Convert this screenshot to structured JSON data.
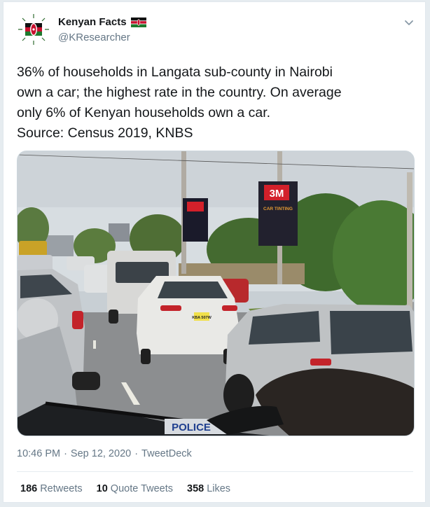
{
  "tweet": {
    "display_name": "Kenyan Facts",
    "handle": "@KResearcher",
    "flag_icon": "kenya-flag-icon",
    "avatar_icon": "kenya-coat-of-arms-icon",
    "text_lines": [
      "36% of households in Langata sub-county in Nairobi",
      "own a car; the highest rate in the country. On average",
      "only 6% of Kenyan households own a car.",
      "Source: Census 2019, KNBS"
    ],
    "time": "10:46 PM",
    "date": "Sep 12, 2020",
    "client": "TweetDeck",
    "separator": "·",
    "retweets_count": "186",
    "retweets_label": "Retweets",
    "quotes_count": "10",
    "quotes_label": "Quote Tweets",
    "likes_count": "358",
    "likes_label": "Likes"
  },
  "photo": {
    "billboard_brand": "3M",
    "billboard_text": "CAR TINTING",
    "plate_text": "KBA 507W",
    "police_text": "POLICE"
  },
  "colors": {
    "link_blue": "#1da1f2",
    "secondary_text": "#657786",
    "primary_text": "#14171a"
  }
}
